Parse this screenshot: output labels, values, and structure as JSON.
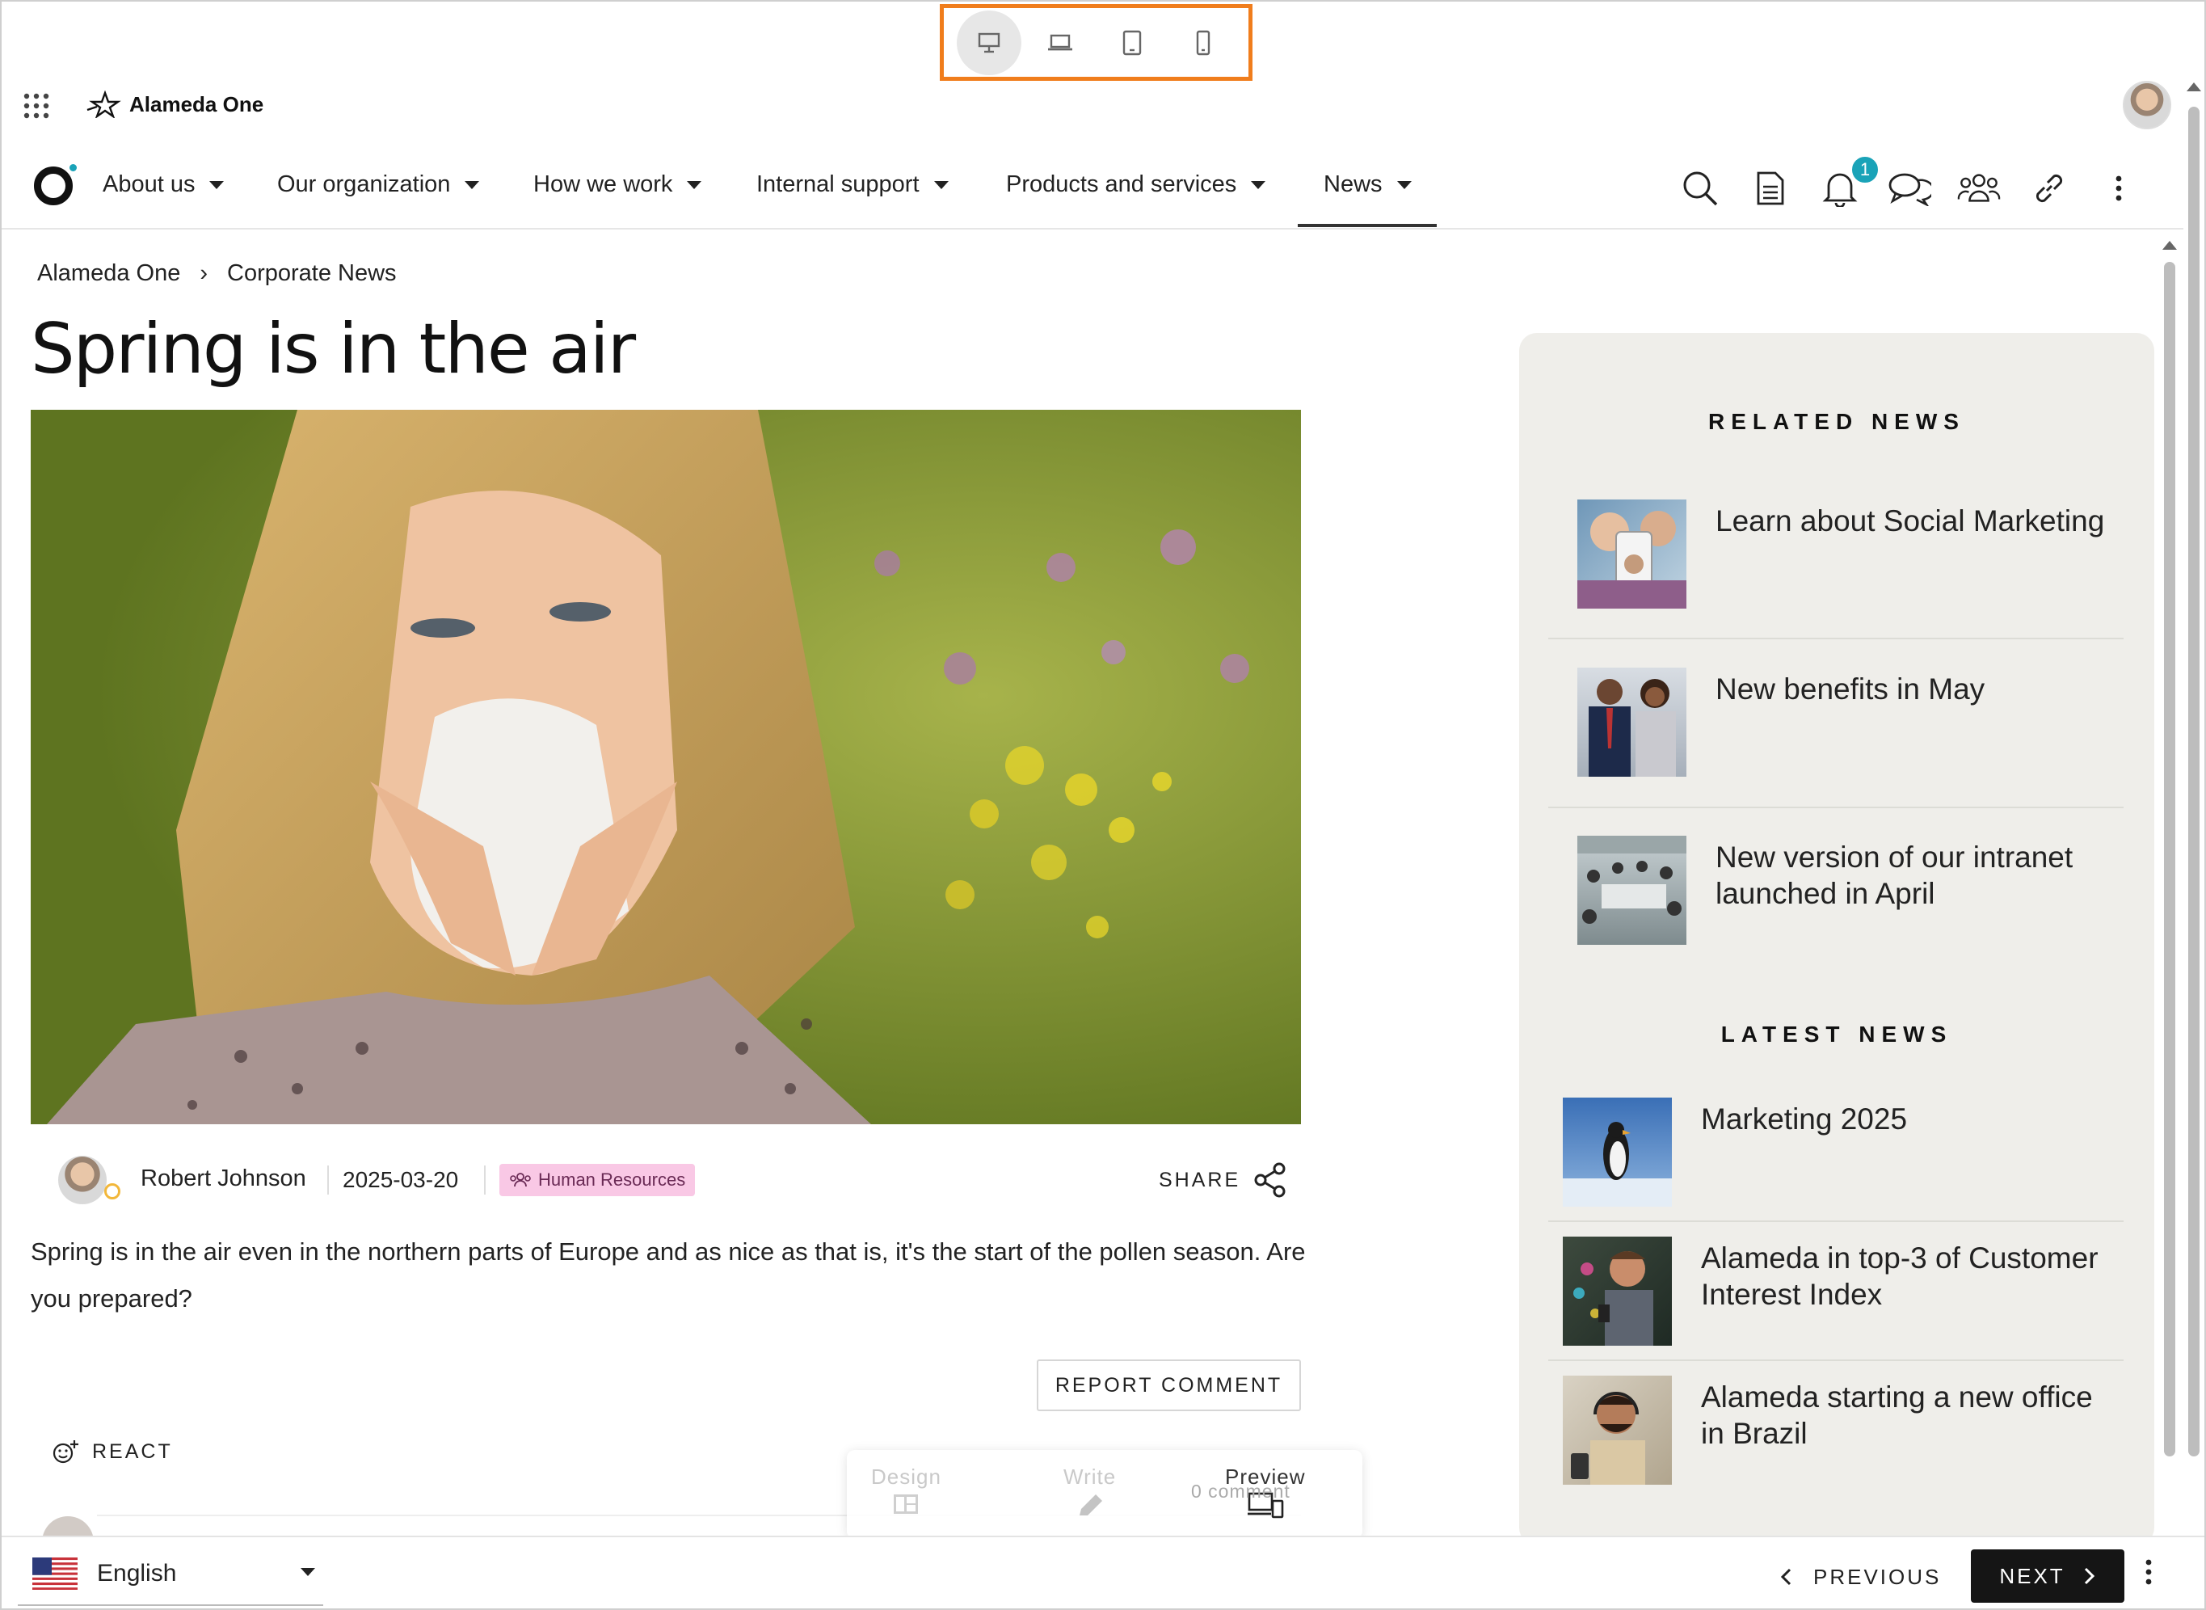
{
  "brand": {
    "name": "Alameda One"
  },
  "device_bar": {
    "devices": [
      "desktop-icon",
      "laptop-icon",
      "tablet-icon",
      "phone-icon"
    ],
    "active": "desktop"
  },
  "nav": {
    "items": [
      {
        "label": "About us"
      },
      {
        "label": "Our organization"
      },
      {
        "label": "How we work"
      },
      {
        "label": "Internal support"
      },
      {
        "label": "Products and services"
      },
      {
        "label": "News"
      }
    ],
    "active": "News",
    "notifications_count": "1",
    "icons": [
      "search-icon",
      "document-icon",
      "bell-icon",
      "chat-icon",
      "people-icon",
      "link-icon",
      "more-icon"
    ]
  },
  "breadcrumb": {
    "root": "Alameda One",
    "separator": "›",
    "current": "Corporate News"
  },
  "article": {
    "title": "Spring is in the air",
    "author": "Robert Johnson",
    "date": "2025-03-20",
    "tag": "Human Resources",
    "share_label": "SHARE",
    "body": "Spring is in the air even in the northern parts of Europe and as nice as that is, it's the start of the pollen season.  Are you prepared?",
    "report_label": "REPORT COMMENT",
    "react_label": "REACT"
  },
  "editor_bar": {
    "design": "Design",
    "write": "Write",
    "preview": "Preview",
    "comment_count": "0 comment"
  },
  "sidebar": {
    "related_heading": "RELATED NEWS",
    "related": [
      {
        "title": "Learn about Social Marketing"
      },
      {
        "title": "New benefits in May"
      },
      {
        "title": "New version of our intranet launched in April"
      }
    ],
    "latest_heading": "LATEST NEWS",
    "latest": [
      {
        "title": "Marketing 2025"
      },
      {
        "title": "Alameda in top-3 of Customer Interest Index"
      },
      {
        "title": "Alameda starting a new office in Brazil"
      }
    ]
  },
  "footer": {
    "language": "English",
    "previous_label": "PREVIOUS",
    "next_label": "NEXT"
  },
  "colors": {
    "accent_orange": "#f07d1c",
    "badge_teal": "#1aa3b8",
    "tag_pink": "#f9c8e5",
    "sidebar_bg": "#efeeea"
  }
}
